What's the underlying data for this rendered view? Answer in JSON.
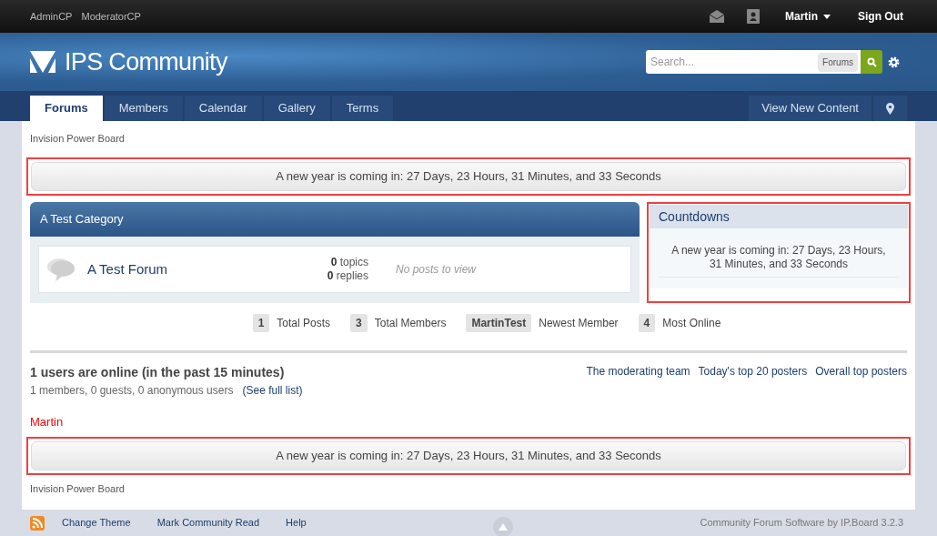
{
  "top_bar": {
    "links": [
      "AdminCP",
      "ModeratorCP"
    ],
    "user": "Martin",
    "sign_out": "Sign Out"
  },
  "header": {
    "logo_text": "IPS Community",
    "search": {
      "placeholder": "Search...",
      "scope": "Forums"
    }
  },
  "nav": {
    "tabs": [
      {
        "label": "Forums",
        "selected": true
      },
      {
        "label": "Members",
        "selected": false
      },
      {
        "label": "Calendar",
        "selected": false
      },
      {
        "label": "Gallery",
        "selected": false
      },
      {
        "label": "Terms",
        "selected": false
      }
    ],
    "right_link": "View New Content"
  },
  "breadcrumb": "Invision Power Board",
  "top_countdown": "A new year is coming in: 27 Days, 23 Hours, 31 Minutes, and 33 Seconds",
  "category": {
    "title": "A Test Category",
    "forums": [
      {
        "name": "A Test Forum",
        "stats": [
          "**0** topics",
          "**0** replies"
        ],
        "last_post": "No posts to view"
      }
    ]
  },
  "sidebar": {
    "title": "Countdowns",
    "text": "A new year is coming in: 27 Days, 23 Hours, 31 Minutes, and 33 Seconds"
  },
  "board_stats": [
    {
      "value": "1",
      "label": "Total Posts"
    },
    {
      "value": "3",
      "label": "Total Members"
    },
    {
      "value": "MartinTest",
      "label": "Newest Member"
    },
    {
      "value": "4",
      "label": "Most Online"
    }
  ],
  "online": {
    "title": "1 users are online (in the past 15 minutes)",
    "summary": "1 members, 0 guests, 0 anonymous users",
    "full_list_link": "(See full list)",
    "links": [
      "The moderating team",
      "Today's top 20 posters",
      "Overall top posters"
    ],
    "users": [
      {
        "name": "Martin",
        "color": "#ff0000"
      }
    ]
  },
  "bottom_countdown": "A new year is coming in: 27 Days, 23 Hours, 31 Minutes, and 33 Seconds",
  "footer_breadcrumb": "Invision Power Board",
  "footer": {
    "links": [
      "Change Theme",
      "Mark Community Read",
      "Help"
    ],
    "copyright": "Community Forum Software by IP.Board 3.2.3"
  }
}
